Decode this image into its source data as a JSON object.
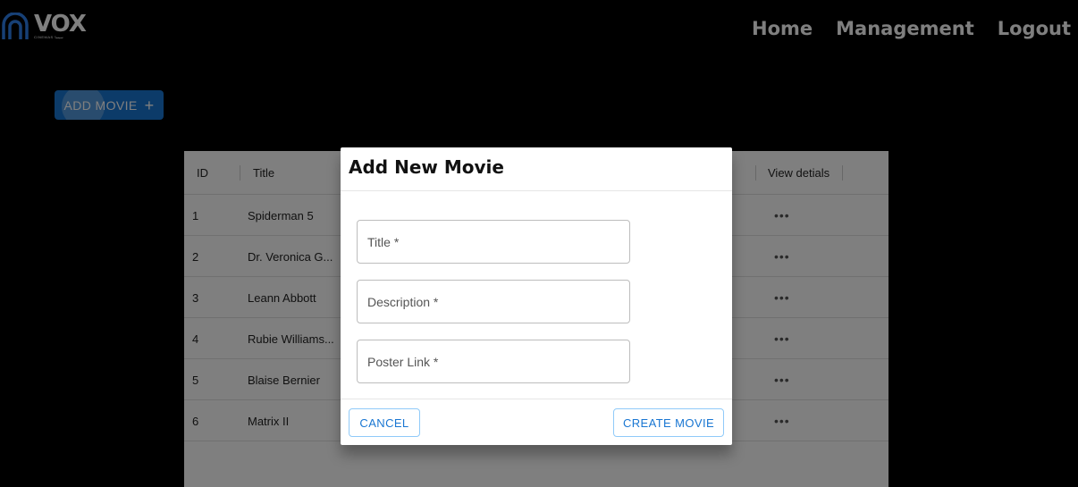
{
  "brand": {
    "name": "VOX",
    "sub": "CINEMAS سينما",
    "color": "#2f80ed"
  },
  "nav": {
    "home": "Home",
    "management": "Management",
    "logout": "Logout"
  },
  "toolbar": {
    "add_label": "ADD MOVIE",
    "add_icon": "plus-icon"
  },
  "table": {
    "headers": [
      "ID",
      "Title",
      "View detials"
    ],
    "rows": [
      {
        "id": "1",
        "title": "Spiderman 5",
        "action": "•••"
      },
      {
        "id": "2",
        "title": "Dr. Veronica G...",
        "action": "•••"
      },
      {
        "id": "3",
        "title": "Leann Abbott",
        "action": "•••"
      },
      {
        "id": "4",
        "title": "Rubie Williams...",
        "action": "•••"
      },
      {
        "id": "5",
        "title": "Blaise Bernier",
        "action": "•••"
      },
      {
        "id": "6",
        "title": "Matrix II",
        "action": "•••"
      }
    ]
  },
  "dialog": {
    "title": "Add New Movie",
    "fields": {
      "title": "Title *",
      "description": "Description *",
      "poster": "Poster Link *"
    },
    "cancel": "CANCEL",
    "create": "CREATE MOVIE"
  },
  "colors": {
    "accent": "#1976d2",
    "background": "#000000"
  }
}
